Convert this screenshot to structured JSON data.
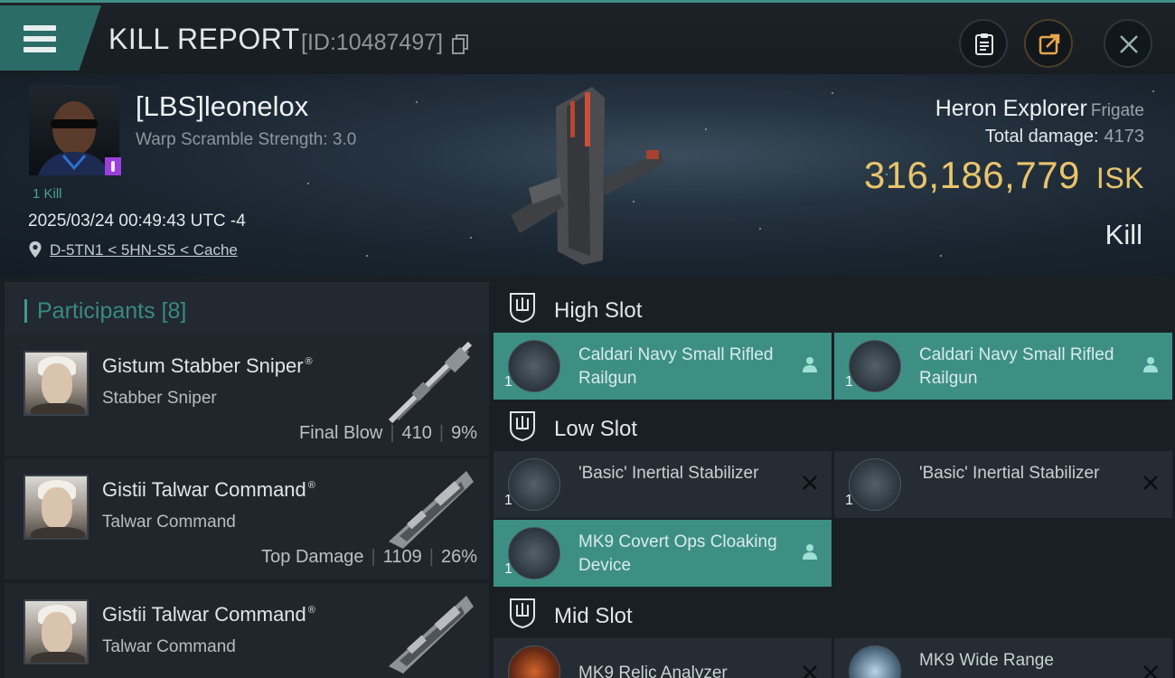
{
  "header": {
    "title": "KILL REPORT",
    "report_id": "[ID:10487497]"
  },
  "victim": {
    "name": "[LBS]leonelox",
    "warp_scramble": "Warp Scramble Strength: 3.0",
    "kills": "1 Kill",
    "datetime": "2025/03/24 00:49:43 UTC -4",
    "location": "D-5TN1 < 5HN-S5 < Cache"
  },
  "ship": {
    "name": "Heron Explorer",
    "class": "Frigate",
    "total_damage_label": "Total damage:",
    "total_damage": "4173",
    "value": "316,186,779",
    "currency": "ISK",
    "result": "Kill"
  },
  "participants": {
    "title": "Participants",
    "count": "[8]",
    "items": [
      {
        "name": "Gistum Stabber Sniper",
        "mark": "®",
        "ship": "Stabber Sniper",
        "label": "Final Blow",
        "damage": "410",
        "percent": "9%"
      },
      {
        "name": "Gistii Talwar Command",
        "mark": "®",
        "ship": "Talwar Command",
        "label": "Top Damage",
        "damage": "1109",
        "percent": "26%"
      },
      {
        "name": "Gistii Talwar Command",
        "mark": "®",
        "ship": "Talwar Command",
        "label": "",
        "damage": "",
        "percent": ""
      }
    ]
  },
  "fitting": {
    "high": {
      "title": "High Slot",
      "modules": [
        {
          "qty": "1",
          "name": "Caldari Navy Small Rifled Railgun",
          "status": "dropped"
        },
        {
          "qty": "1",
          "name": "Caldari Navy Small Rifled Railgun",
          "status": "dropped"
        }
      ]
    },
    "low": {
      "title": "Low Slot",
      "modules": [
        {
          "qty": "1",
          "name": "'Basic' Inertial Stabilizer",
          "status": "destroyed"
        },
        {
          "qty": "1",
          "name": "'Basic' Inertial Stabilizer",
          "status": "destroyed"
        },
        {
          "qty": "1",
          "name": "MK9 Covert Ops Cloaking Device",
          "status": "dropped"
        }
      ]
    },
    "mid": {
      "title": "Mid Slot",
      "modules": [
        {
          "qty": "",
          "name": "MK9 Relic Analyzer",
          "status": "destroyed"
        },
        {
          "qty": "",
          "name": "MK9 Wide Range",
          "status": "destroyed"
        }
      ]
    }
  },
  "colors": {
    "accent": "#3d8f84",
    "isk": "#e8c46c",
    "corp_badge": "#9b3fdc"
  }
}
